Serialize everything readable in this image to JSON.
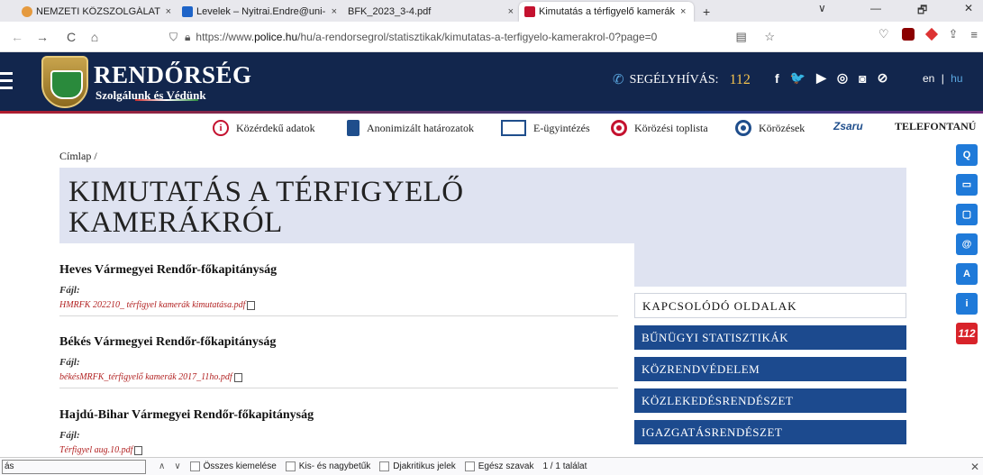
{
  "browser": {
    "tabs": [
      {
        "title": "NEMZETI KÖZSZOLGÁLATI EGYE",
        "close": "×",
        "fav_color": "#e59a3f",
        "active": false
      },
      {
        "title": "Levelek – Nyitrai.Endre@uni-nk",
        "close": "×",
        "fav_color": "#1e64c8",
        "active": false
      },
      {
        "title": "BFK_2023_3-4.pdf",
        "close": "×",
        "fav_color": "#e8e8ed",
        "active": false
      },
      {
        "title": "Kimutatás a térfigyelő kamerák",
        "close": "×",
        "fav_color": "#c4122f",
        "active": true
      }
    ],
    "new_tab": "+",
    "window_controls": {
      "dropdown": "∨",
      "minimize": "—",
      "restore": "🗗",
      "close": "✕"
    },
    "nav": {
      "back": "←",
      "forward": "→",
      "reload": "C",
      "home": "⌂"
    },
    "url_prefix": "https://www.",
    "url_domain": "police.hu",
    "url_path": "/hu/a-rendorsegrol/statisztikak/kimutatas-a-terfigyelo-kamerakrol-0?page=0",
    "url_icons": "▤ ☆",
    "toolbar_icons": [
      "shield-icon",
      "extension-icon",
      "share-icon",
      "menu-icon"
    ]
  },
  "site": {
    "brand": "RENDŐRSÉG",
    "slogan": "Szolgálunk és Védünk",
    "hotline_label": "SEGÉLYHÍVÁS:",
    "hotline_number": "112",
    "social": [
      "f",
      "🐦",
      "▶",
      "◎",
      "◙",
      "⊘"
    ],
    "lang_en": "en",
    "lang_sep": "|",
    "lang_hu": "hu",
    "colors": {
      "header": "#12264d",
      "accent": "#1c4a8e",
      "link": "#b22222"
    }
  },
  "quicklinks": [
    {
      "label": "Közérdekű adatok",
      "icon": "info-icon"
    },
    {
      "label": "Anonimizált határozatok",
      "icon": "document-icon"
    },
    {
      "label": "E-ügyintézés",
      "icon": "screen-icon"
    },
    {
      "label": "Körözési toplista",
      "icon": "target-icon"
    },
    {
      "label": "Körözések",
      "icon": "target-icon"
    },
    {
      "label": "Zsaru",
      "icon": "zsaru-logo"
    },
    {
      "label": "TELEFONTANÚ",
      "icon": ""
    }
  ],
  "breadcrumb": "Címlap /",
  "page_title_line1": "KIMUTATÁS A TÉRFIGYELŐ",
  "page_title_line2": "KAMERÁKRÓL",
  "entries": [
    {
      "title": "Heves Vármegyei Rendőr-főkapitányság",
      "file_label": "Fájl:",
      "file": "HMRFK 202210_ térfigyel kamerák kimutatása.pdf"
    },
    {
      "title": "Békés Vármegyei Rendőr-főkapitányság",
      "file_label": "Fájl:",
      "file": "békésMRFK_térfigyelő kamerák 2017_11ho.pdf"
    },
    {
      "title": "Hajdú-Bihar Vármegyei Rendőr-főkapitányság",
      "file_label": "Fájl:",
      "file": "Térfigyel aug.10.pdf"
    }
  ],
  "sidebar": {
    "heading": "KAPCSOLÓDÓ OLDALAK",
    "links": [
      "BŰNÜGYI STATISZTIKÁK",
      "KÖZRENDVÉDELEM",
      "KÖZLEKEDÉSRENDÉSZET",
      "IGAZGATÁSRENDÉSZET"
    ]
  },
  "side_tools": [
    "Q",
    "▭",
    "▢",
    "@",
    "A",
    "i",
    "112"
  ],
  "findbar": {
    "query": "ás",
    "up": "∧",
    "down": "∨",
    "options": [
      "Összes kiemelése",
      "Kis- és nagybetűk",
      "Djakritikus jelek",
      "Egész szavak"
    ],
    "count": "1 / 1 találat",
    "close": "✕"
  }
}
